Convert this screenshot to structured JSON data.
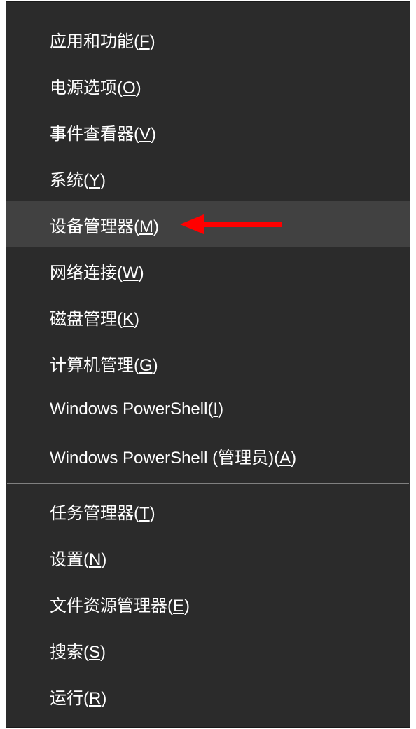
{
  "menu": {
    "sections": [
      {
        "items": [
          {
            "id": "apps-features",
            "text": "应用和功能",
            "accelerator": "F",
            "highlighted": false,
            "annotated": false
          },
          {
            "id": "power-options",
            "text": "电源选项",
            "accelerator": "O",
            "highlighted": false,
            "annotated": false
          },
          {
            "id": "event-viewer",
            "text": "事件查看器",
            "accelerator": "V",
            "highlighted": false,
            "annotated": false
          },
          {
            "id": "system",
            "text": "系统",
            "accelerator": "Y",
            "highlighted": false,
            "annotated": false
          },
          {
            "id": "device-manager",
            "text": "设备管理器",
            "accelerator": "M",
            "highlighted": true,
            "annotated": true
          },
          {
            "id": "network-connections",
            "text": "网络连接",
            "accelerator": "W",
            "highlighted": false,
            "annotated": false
          },
          {
            "id": "disk-management",
            "text": "磁盘管理",
            "accelerator": "K",
            "highlighted": false,
            "annotated": false
          },
          {
            "id": "computer-management",
            "text": "计算机管理",
            "accelerator": "G",
            "highlighted": false,
            "annotated": false
          },
          {
            "id": "powershell",
            "text": "Windows PowerShell",
            "accelerator": "I",
            "highlighted": false,
            "annotated": false
          },
          {
            "id": "powershell-admin",
            "text": "Windows PowerShell (管理员)",
            "accelerator": "A",
            "highlighted": false,
            "annotated": false
          }
        ]
      },
      {
        "items": [
          {
            "id": "task-manager",
            "text": "任务管理器",
            "accelerator": "T",
            "highlighted": false,
            "annotated": false
          },
          {
            "id": "settings",
            "text": "设置",
            "accelerator": "N",
            "highlighted": false,
            "annotated": false
          },
          {
            "id": "file-explorer",
            "text": "文件资源管理器",
            "accelerator": "E",
            "highlighted": false,
            "annotated": false
          },
          {
            "id": "search",
            "text": "搜索",
            "accelerator": "S",
            "highlighted": false,
            "annotated": false
          },
          {
            "id": "run",
            "text": "运行",
            "accelerator": "R",
            "highlighted": false,
            "annotated": false
          }
        ]
      }
    ]
  },
  "colors": {
    "menu_bg": "#2b2b2b",
    "highlight_bg": "#414141",
    "text": "#ffffff",
    "separator": "#808080",
    "arrow": "#ff0000"
  }
}
